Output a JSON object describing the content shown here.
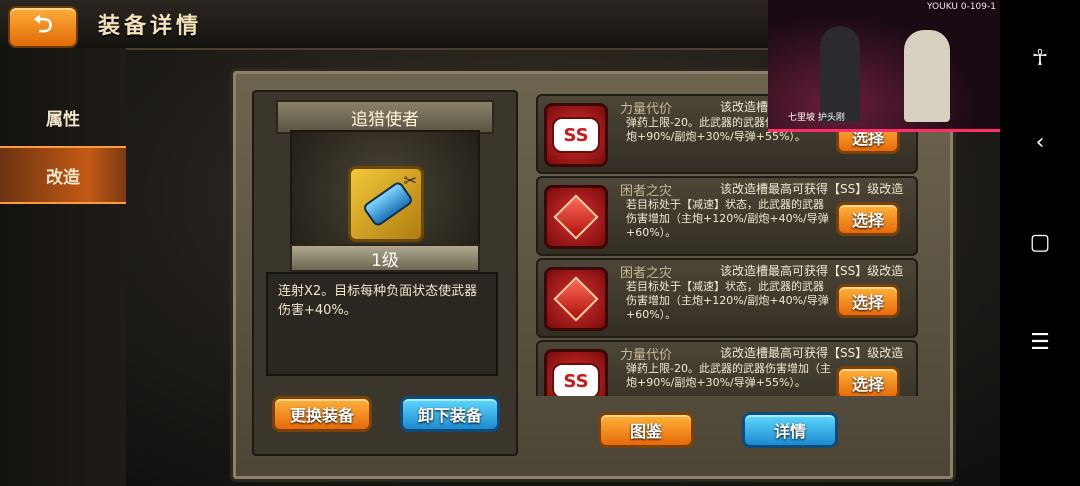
{
  "header": {
    "title": "装备详情",
    "back_icon": "back-arrow-icon"
  },
  "sidebar": {
    "items": [
      {
        "label": "属性",
        "active": false
      },
      {
        "label": "改造",
        "active": true
      }
    ]
  },
  "equipment": {
    "name": "追猎使者",
    "level": "1级",
    "description": "连射X2。目标每种负面状态使武器伤害+40%。",
    "buttons": {
      "replace": "更换装备",
      "unequip": "卸下装备"
    }
  },
  "mods": [
    {
      "badge": "SS",
      "icon": "ss-badge-icon",
      "title": "力量代价",
      "hint": "该改造槽最高可获得【SS】级改造",
      "text": "弹药上限-20。此武器的武器伤害增加（主炮+90%/副炮+30%/导弹+55%）。",
      "button": "选择"
    },
    {
      "badge": "",
      "icon": "red-gem-icon",
      "title": "困者之灾",
      "hint": "该改造槽最高可获得【SS】级改造",
      "text": "若目标处于【减速】状态，此武器的武器伤害增加（主炮+120%/副炮+40%/导弹+60%）。",
      "button": "选择"
    },
    {
      "badge": "",
      "icon": "red-gem-icon",
      "title": "困者之灾",
      "hint": "该改造槽最高可获得【SS】级改造",
      "text": "若目标处于【减速】状态，此武器的武器伤害增加（主炮+120%/副炮+40%/导弹+60%）。",
      "button": "选择"
    },
    {
      "badge": "SS",
      "icon": "ss-badge-icon",
      "title": "力量代价",
      "hint": "该改造槽最高可获得【SS】级改造",
      "text": "弹药上限-20。此武器的武器伤害增加（主炮+90%/副炮+30%/导弹+55%）。",
      "button": "选择"
    }
  ],
  "footer": {
    "catalog": "图鉴",
    "details": "详情"
  },
  "video_overlay": {
    "watermark": "YOUKU",
    "code": "0-109-1",
    "caption": "七里坡 护头刚"
  },
  "system_nav": {
    "icons": [
      "accessibility-icon",
      "back-icon",
      "home-icon",
      "menu-icon"
    ]
  },
  "colors": {
    "accent_orange": "#e86a0a",
    "accent_blue": "#1b8ad0",
    "panel": "#4c4536"
  }
}
